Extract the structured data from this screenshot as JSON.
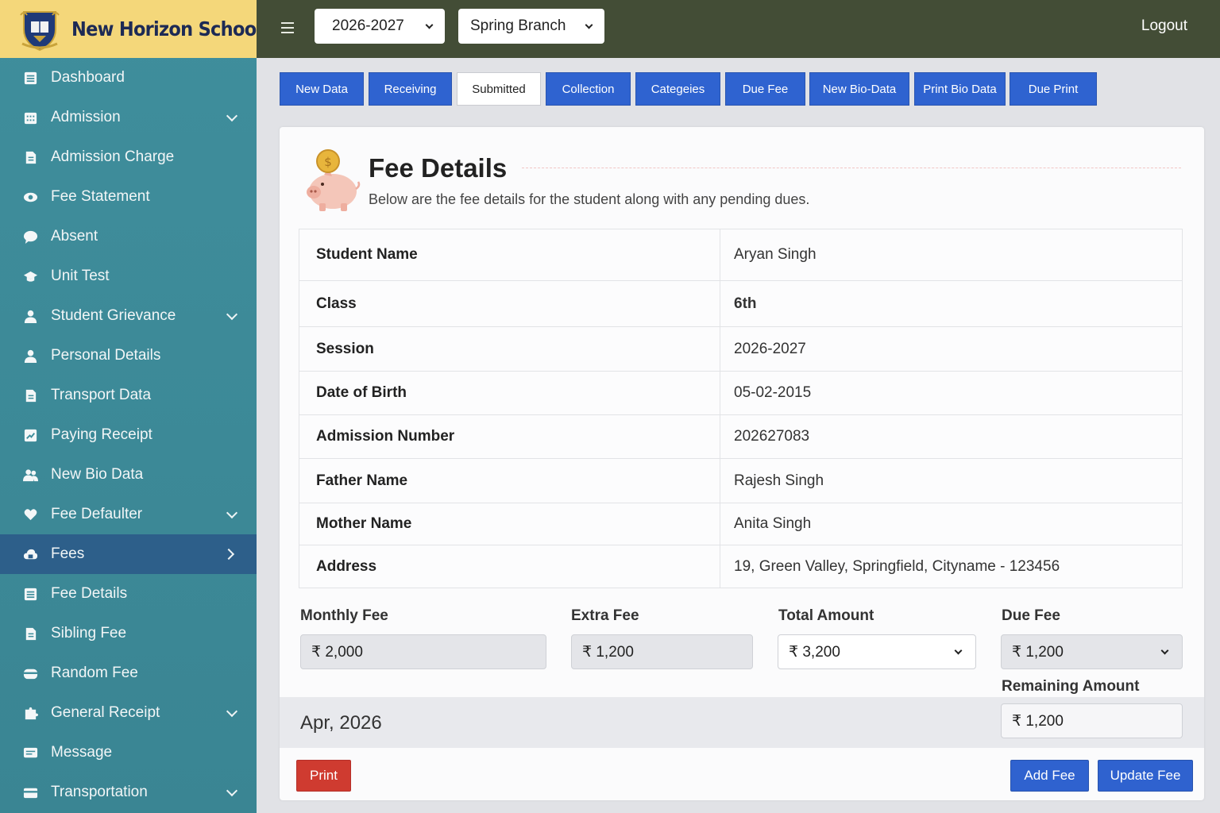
{
  "brand": {
    "name": "New Horizon School"
  },
  "sidebar": {
    "items": [
      {
        "label": "Dashboard",
        "icon": "list-alt-icon"
      },
      {
        "label": "Admission",
        "icon": "calendar-grid-icon",
        "chevron": "down"
      },
      {
        "label": "Admission Charge",
        "icon": "document-icon"
      },
      {
        "label": "Fee Statement",
        "icon": "eye-icon"
      },
      {
        "label": "Absent",
        "icon": "comment-icon"
      },
      {
        "label": "Unit Test",
        "icon": "graduation-cap-icon"
      },
      {
        "label": "Student Grievance",
        "icon": "user-icon",
        "chevron": "down"
      },
      {
        "label": "Personal Details",
        "icon": "user-icon"
      },
      {
        "label": "Transport Data",
        "icon": "document-icon"
      },
      {
        "label": "Paying Receipt",
        "icon": "chart-icon"
      },
      {
        "label": "New Bio Data",
        "icon": "users-icon"
      },
      {
        "label": "Fee Defaulter",
        "icon": "heart-hand-icon",
        "chevron": "down"
      },
      {
        "label": "Fees",
        "icon": "cloud-lock-icon",
        "chevron": "right",
        "active": true
      },
      {
        "label": "Fee Details",
        "icon": "list-alt-icon"
      },
      {
        "label": "Sibling Fee",
        "icon": "document-icon"
      },
      {
        "label": "Random Fee",
        "icon": "credit-card-icon"
      },
      {
        "label": "General Receipt",
        "icon": "puzzle-icon",
        "chevron": "down"
      },
      {
        "label": "Message",
        "icon": "message-icon"
      },
      {
        "label": "Transportation",
        "icon": "card-icon",
        "chevron": "down"
      }
    ]
  },
  "topbar": {
    "session": "2026-2027",
    "branch": "Spring Branch",
    "logout": "Logout"
  },
  "tabs": [
    "New Data",
    "Receiving",
    "Submitted",
    "Collection",
    "Categeies",
    "Due Fee",
    "New Bio-Data",
    "Print Bio Data",
    "Due Print"
  ],
  "active_tab": "Submitted",
  "card": {
    "title": "Fee Details",
    "subtitle": "Below are the fee details for the student along with any pending dues."
  },
  "details": [
    {
      "key": "Student Name",
      "value": "Aryan Singh"
    },
    {
      "key": "Class",
      "value": "6th"
    },
    {
      "key": "Session",
      "value": "2026-2027"
    },
    {
      "key": "Date of Birth",
      "value": "05-02-2015"
    },
    {
      "key": "Admission Number",
      "value": "202627083"
    },
    {
      "key": "Father Name",
      "value": "Rajesh Singh"
    },
    {
      "key": "Mother Name",
      "value": "Anita Singh"
    },
    {
      "key": "Address",
      "value": "19, Green Valley, Springfield, Cityname - 123456"
    }
  ],
  "fees": {
    "monthly_label": "Monthly Fee",
    "monthly_value": "₹ 2,000",
    "extra_label": "Extra Fee",
    "extra_value": "₹ 1,200",
    "total_label": "Total Amount",
    "total_value": "₹ 3,200",
    "due_label": "Due Fee",
    "due_value": "₹ 1,200",
    "remaining_label": "Remaining Amount",
    "remaining_value": "₹ 1,200"
  },
  "month": "Apr, 2026",
  "buttons": {
    "print": "Print",
    "add": "Add Fee",
    "update": "Update Fee"
  },
  "colors": {
    "sidebar": "#3f8e9c",
    "brand_bg": "#f4d77a",
    "topbar": "#434d36",
    "primary": "#2f63d0",
    "danger": "#cf3b30",
    "active_item": "#2d5f8a"
  }
}
